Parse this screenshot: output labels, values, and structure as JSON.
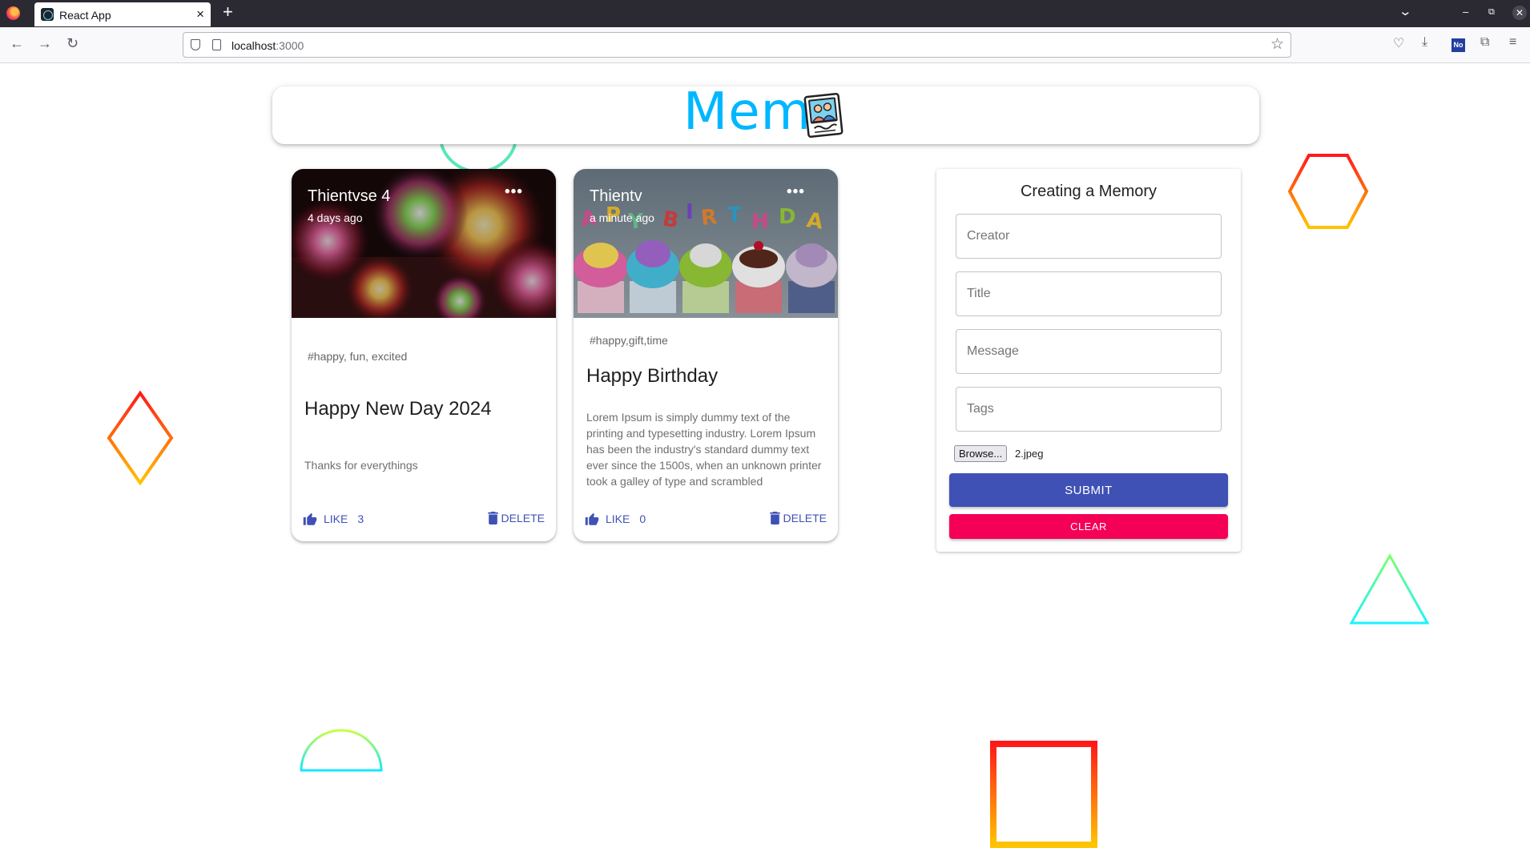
{
  "browser": {
    "tab_title": "React App",
    "url_host": "localhost",
    "url_port": ":3000"
  },
  "app": {
    "brand": "Mem",
    "accent_color": "#00b7ff"
  },
  "posts": [
    {
      "creator": "Thientvse 4",
      "time": "4 days ago",
      "tags": "#happy, fun, excited",
      "title": "Happy New Day 2024",
      "message": "Thanks for everythings",
      "like_label": "LIKE",
      "like_count": "3",
      "delete_label": "DELETE",
      "image": "fireworks"
    },
    {
      "creator": "Thientv",
      "time": "a minute ago",
      "tags": "#happy,gift,time",
      "title": "Happy Birthday",
      "message": "Lorem Ipsum is simply dummy text of the printing and typesetting industry. Lorem Ipsum has been the industry's standard dummy text ever since the 1500s, when an unknown printer took a galley of type and scrambled",
      "like_label": "LIKE",
      "like_count": "0",
      "delete_label": "DELETE",
      "image": "birthday-cupcakes",
      "banner_letters": "HAPPY BIRTHDA"
    }
  ],
  "form": {
    "heading": "Creating a Memory",
    "creator_placeholder": "Creator",
    "title_placeholder": "Title",
    "message_placeholder": "Message",
    "tags_placeholder": "Tags",
    "browse_label": "Browse...",
    "file_name": "2.jpeg",
    "submit_label": "SUBMIT",
    "clear_label": "CLEAR",
    "submit_color": "#3f51b5",
    "clear_color": "#f50057"
  }
}
